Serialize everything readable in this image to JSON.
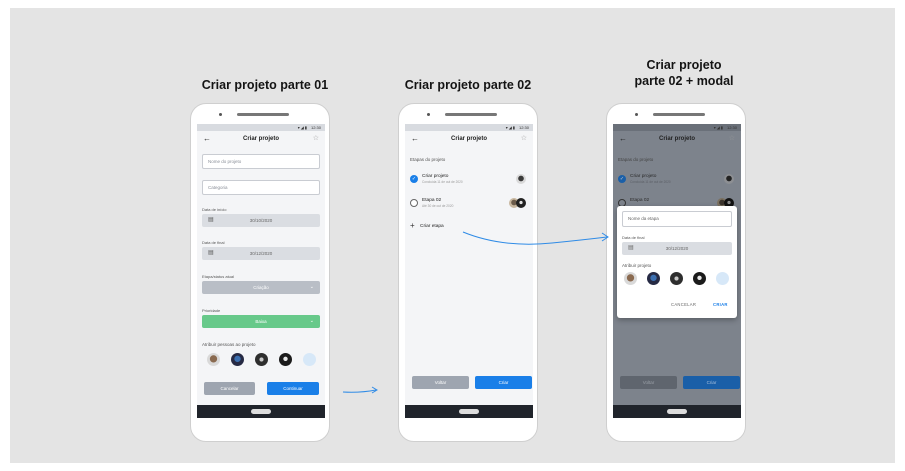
{
  "titles": {
    "screen1": "Criar projeto parte 01",
    "screen2": "Criar projeto parte 02",
    "screen3_line1": "Criar projeto",
    "screen3_line2": "parte 02 + modal"
  },
  "status": {
    "time": "12:30",
    "icons": "▾◢▮"
  },
  "appbar": {
    "title": "Criar projeto",
    "back": "←",
    "star": "☆"
  },
  "screen1": {
    "name_placeholder": "Nome do projeto",
    "category_placeholder": "Categoria",
    "start_label": "Data de início",
    "start_value": "30/10/2020",
    "end_label": "Data de final",
    "end_value": "30/12/2020",
    "stage_label": "Etapa/status atual",
    "stage_value": "Criação",
    "priority_label": "Prioridade",
    "priority_value": "Baixa",
    "people_label": "Atribuir pessoas ao projeto",
    "cancel": "Cancelar",
    "continue": "Continuar"
  },
  "screen2": {
    "section": "Etapas do projeto",
    "etapas": [
      {
        "title": "Criar projeto",
        "sub": "Concluída 11 de out de 2020"
      },
      {
        "title": "Etapa 02",
        "sub": "Até 30 de out de 2020"
      }
    ],
    "add": "Criar etapa",
    "back": "Voltar",
    "create": "Criar"
  },
  "modal": {
    "name_placeholder": "Nome da etapa",
    "end_label": "Data de final",
    "end_value": "30/12/2020",
    "assign_label": "Atribuir projeto",
    "cancel": "CANCELAR",
    "create": "CRIAR"
  },
  "colors": {
    "accent": "#1a7fe8",
    "green": "#67c98a",
    "gray_btn": "#9ea5b0",
    "select_gray": "#b9bec6",
    "overlay": "#7d838c"
  }
}
